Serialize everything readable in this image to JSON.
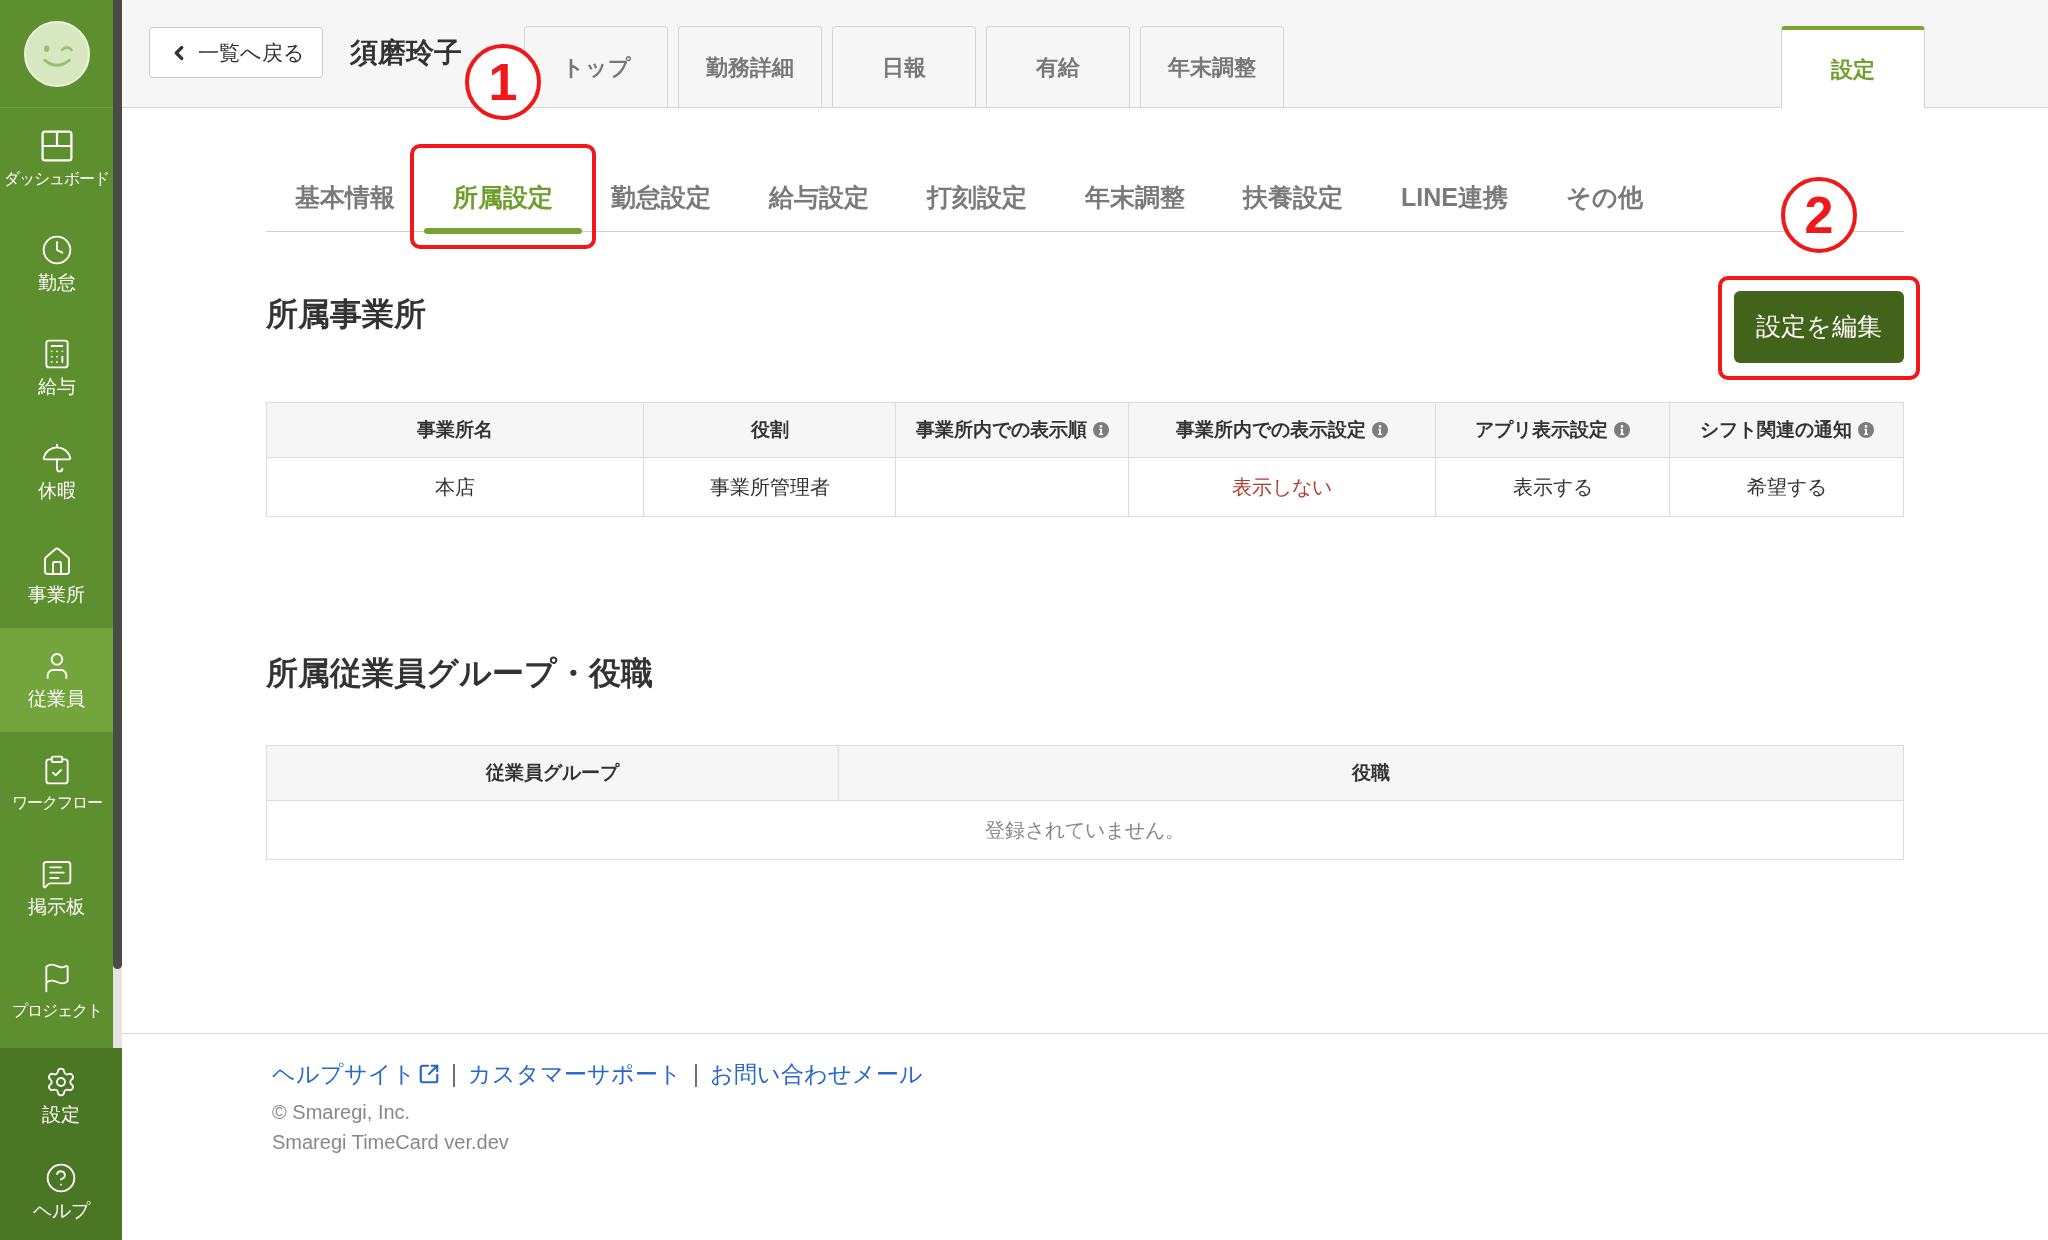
{
  "sidebar": {
    "items": [
      {
        "label": "ダッシュボード",
        "selected": false
      },
      {
        "label": "勤怠",
        "selected": false
      },
      {
        "label": "給与",
        "selected": false
      },
      {
        "label": "休暇",
        "selected": false
      },
      {
        "label": "事業所",
        "selected": false
      },
      {
        "label": "従業員",
        "selected": true
      },
      {
        "label": "ワークフロー",
        "selected": false
      },
      {
        "label": "掲示板",
        "selected": false
      },
      {
        "label": "プロジェクト",
        "selected": false
      }
    ],
    "bottom_items": [
      {
        "label": "設定"
      },
      {
        "label": "ヘルプ"
      }
    ]
  },
  "header": {
    "back_button": "一覧へ戻る",
    "employee_name": "須磨玲子",
    "tabs": [
      {
        "label": "トップ",
        "selected": false
      },
      {
        "label": "勤務詳細",
        "selected": false
      },
      {
        "label": "日報",
        "selected": false
      },
      {
        "label": "有給",
        "selected": false
      },
      {
        "label": "年末調整",
        "selected": false
      }
    ],
    "end_tabs": [
      {
        "label": "設定",
        "selected": true
      }
    ]
  },
  "sub_tabs": [
    {
      "label": "基本情報",
      "selected": false
    },
    {
      "label": "所属設定",
      "selected": true,
      "callout": "1"
    },
    {
      "label": "勤怠設定",
      "selected": false
    },
    {
      "label": "給与設定",
      "selected": false
    },
    {
      "label": "打刻設定",
      "selected": false
    },
    {
      "label": "年末調整",
      "selected": false
    },
    {
      "label": "扶養設定",
      "selected": false
    },
    {
      "label": "LINE連携",
      "selected": false
    },
    {
      "label": "その他",
      "selected": false
    }
  ],
  "sections": [
    {
      "title": "所属事業所",
      "button": {
        "label": "設定を編集",
        "callout": "2"
      },
      "table": {
        "columns": [
          {
            "label": "事業所名",
            "info": false
          },
          {
            "label": "役割",
            "info": false
          },
          {
            "label": "事業所内での表示順",
            "info": true
          },
          {
            "label": "事業所内での表示設定",
            "info": true
          },
          {
            "label": "アプリ表示設定",
            "info": true
          },
          {
            "label": "シフト関連の通知",
            "info": true
          }
        ],
        "rows": [
          {
            "cells": [
              {
                "text": "本店",
                "kind": "plain"
              },
              {
                "text": "事業所管理者",
                "kind": "plain"
              },
              null,
              {
                "text": "表示しない",
                "kind": "negative"
              },
              {
                "text": "表示する",
                "kind": "plain"
              },
              {
                "text": "希望する",
                "kind": "plain"
              }
            ]
          }
        ]
      }
    },
    {
      "title": "所属従業員グループ・役職",
      "table": {
        "columns": [
          {
            "label": "従業員グループ",
            "info": false
          },
          {
            "label": "役職",
            "info": false
          }
        ],
        "empty_message": "登録されていません。"
      }
    }
  ],
  "footer": {
    "links": [
      {
        "label": "ヘルプサイト",
        "external": true
      },
      {
        "label": "カスタマーサポート",
        "external": false
      },
      {
        "label": "お問い合わせメール",
        "external": false
      }
    ],
    "separator": "|",
    "copyright": "© Smaregi, Inc.",
    "version": "Smaregi TimeCard ver.dev"
  }
}
